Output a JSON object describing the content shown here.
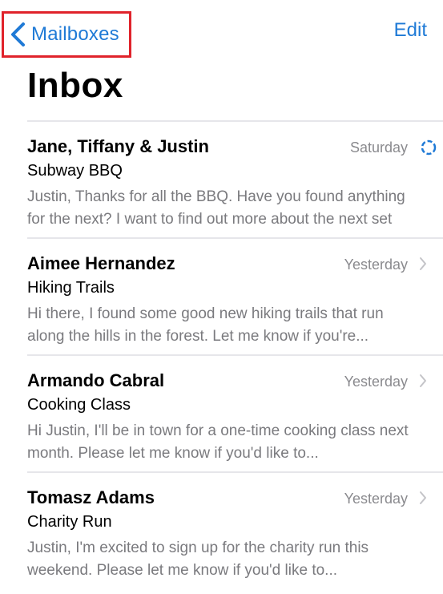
{
  "nav": {
    "back_label": "Mailboxes",
    "edit_label": "Edit",
    "accent_color": "#1f7ad6",
    "highlight_color": "#e0232b"
  },
  "page": {
    "title": "Inbox"
  },
  "messages": [
    {
      "sender": "Jane, Tiffany & Justin",
      "date": "Saturday",
      "subject": "Subway BBQ",
      "preview": "Justin, Thanks for all the BBQ. Have you found anything for the next? I want to find out more about the next set of..."
    },
    {
      "sender": "Aimee Hernandez",
      "date": "Yesterday",
      "subject": "Hiking Trails",
      "preview": "Hi there, I found some good new hiking trails that run along the hills in the forest. Let me know if you're..."
    },
    {
      "sender": "Armando Cabral",
      "date": "Yesterday",
      "subject": "Cooking Class",
      "preview": "Hi Justin, I'll be in town for a one-time cooking class next month. Please let me know if you'd like to..."
    },
    {
      "sender": "Tomasz Adams",
      "date": "Yesterday",
      "subject": "Charity Run",
      "preview": "Justin, I'm excited to sign up for the charity run this weekend. Please let me know if you'd like to..."
    }
  ]
}
